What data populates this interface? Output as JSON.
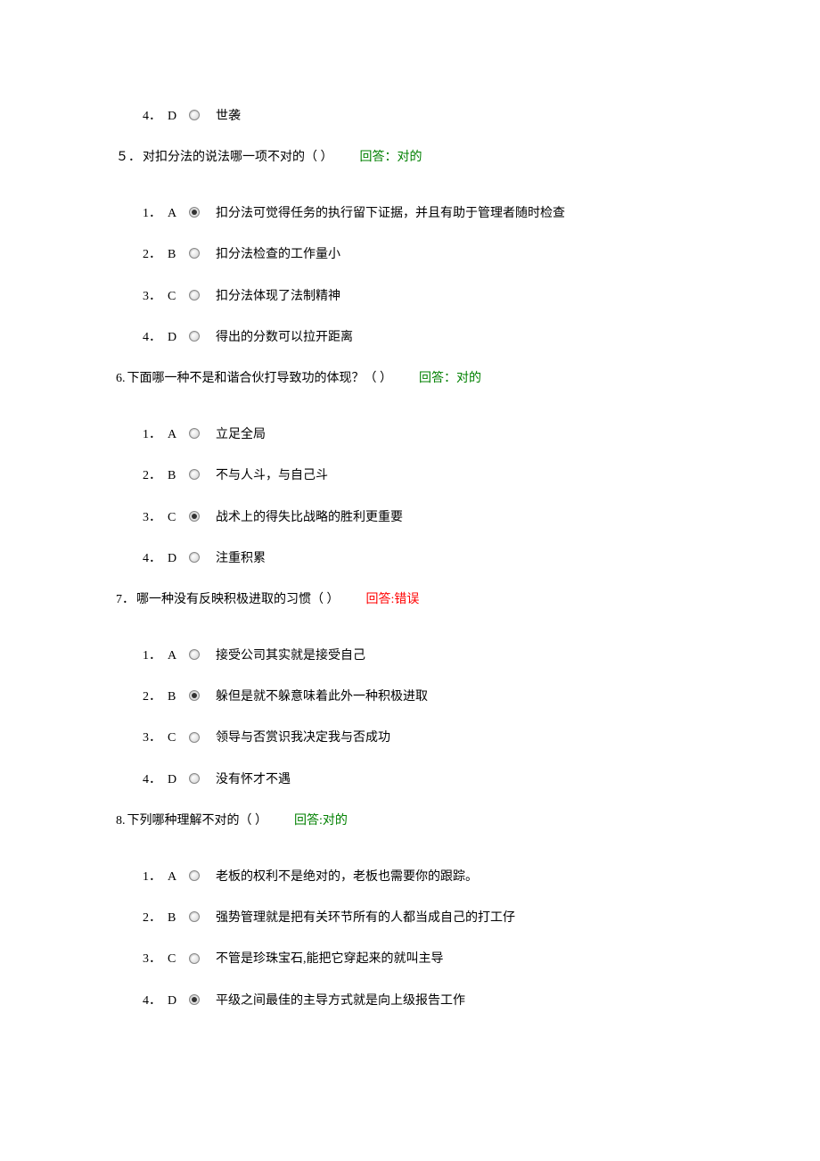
{
  "orphan": {
    "index": "4．",
    "letter": "D",
    "selected": false,
    "text": "世袭"
  },
  "questions": [
    {
      "number": "５．",
      "stem": "对扣分法的说法哪一项不对的（ ）",
      "feedback_label": "回答：对的",
      "feedback_status": "correct",
      "options": [
        {
          "index": "1．",
          "letter": "A",
          "selected": true,
          "text": "扣分法可觉得任务的执行留下证据，并且有助于管理者随时检查"
        },
        {
          "index": "2．",
          "letter": "B",
          "selected": false,
          "text": "扣分法检查的工作量小"
        },
        {
          "index": "3．",
          "letter": "C",
          "selected": false,
          "text": "扣分法体现了法制精神"
        },
        {
          "index": "4．",
          "letter": "D",
          "selected": false,
          "text": "得出的分数可以拉开距离"
        }
      ]
    },
    {
      "number": "6.",
      "stem": " 下面哪一种不是和谐合伙打导致功的体现？（  ）",
      "feedback_label": "回答：对的",
      "feedback_status": "correct",
      "options": [
        {
          "index": "1．",
          "letter": "A",
          "selected": false,
          "text": "立足全局"
        },
        {
          "index": "2．",
          "letter": "B",
          "selected": false,
          "text": "不与人斗，与自己斗"
        },
        {
          "index": "3．",
          "letter": "C",
          "selected": true,
          "text": "战术上的得失比战略的胜利更重要"
        },
        {
          "index": "4．",
          "letter": "D",
          "selected": false,
          "text": "注重积累"
        }
      ]
    },
    {
      "number": "7．",
      "stem": "哪一种没有反映积极进取的习惯（   ）",
      "feedback_label": "回答:错误",
      "feedback_status": "wrong",
      "options": [
        {
          "index": "1．",
          "letter": "A",
          "selected": false,
          "text": "接受公司其实就是接受自己"
        },
        {
          "index": "2．",
          "letter": "B",
          "selected": true,
          "text": "躲但是就不躲意味着此外一种积极进取"
        },
        {
          "index": "3．",
          "letter": "C",
          "selected": false,
          "text": "领导与否赏识我决定我与否成功"
        },
        {
          "index": "4．",
          "letter": "D",
          "selected": false,
          "text": "没有怀才不遇"
        }
      ]
    },
    {
      "number": "8.  ",
      "stem": "下列哪种理解不对的（  ）",
      "feedback_label": "回答:对的",
      "feedback_status": "correct",
      "options": [
        {
          "index": "1．",
          "letter": "A",
          "selected": false,
          "text": "老板的权利不是绝对的，老板也需要你的跟踪。"
        },
        {
          "index": "2．",
          "letter": "B",
          "selected": false,
          "text": "强势管理就是把有关环节所有的人都当成自己的打工仔"
        },
        {
          "index": "3．",
          "letter": "C",
          "selected": false,
          "text": "不管是珍珠宝石,能把它穿起来的就叫主导"
        },
        {
          "index": "4．",
          "letter": "D",
          "selected": true,
          "text": "平级之间最佳的主导方式就是向上级报告工作"
        }
      ]
    }
  ]
}
